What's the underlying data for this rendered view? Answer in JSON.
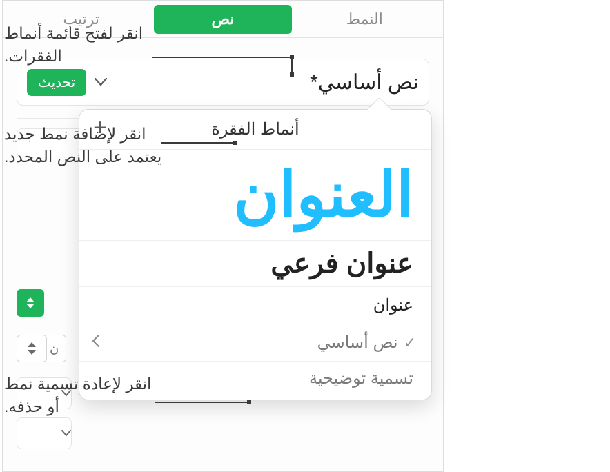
{
  "tabs": {
    "style": "النمط",
    "text": "نص",
    "arrange": "ترتيب"
  },
  "style_row": {
    "name": "نص أساسي*",
    "update": "تحديث"
  },
  "stepper_field_glimpse": "ن",
  "popover": {
    "title": "أنماط الفقرة",
    "items": {
      "title": "العنوان",
      "subtitle": "عنوان فرعي",
      "heading": "عنوان",
      "body": "نص أساسي",
      "caption": "تسمية توضيحية"
    }
  },
  "callouts": {
    "open_menu": "انقر لفتح قائمة أنماط الفقرات.",
    "add_style": "انقر لإضافة نمط جديد يعتمد على النص المحدد.",
    "rename_delete": "انقر لإعادة تسمية نمط أو حذفه."
  }
}
